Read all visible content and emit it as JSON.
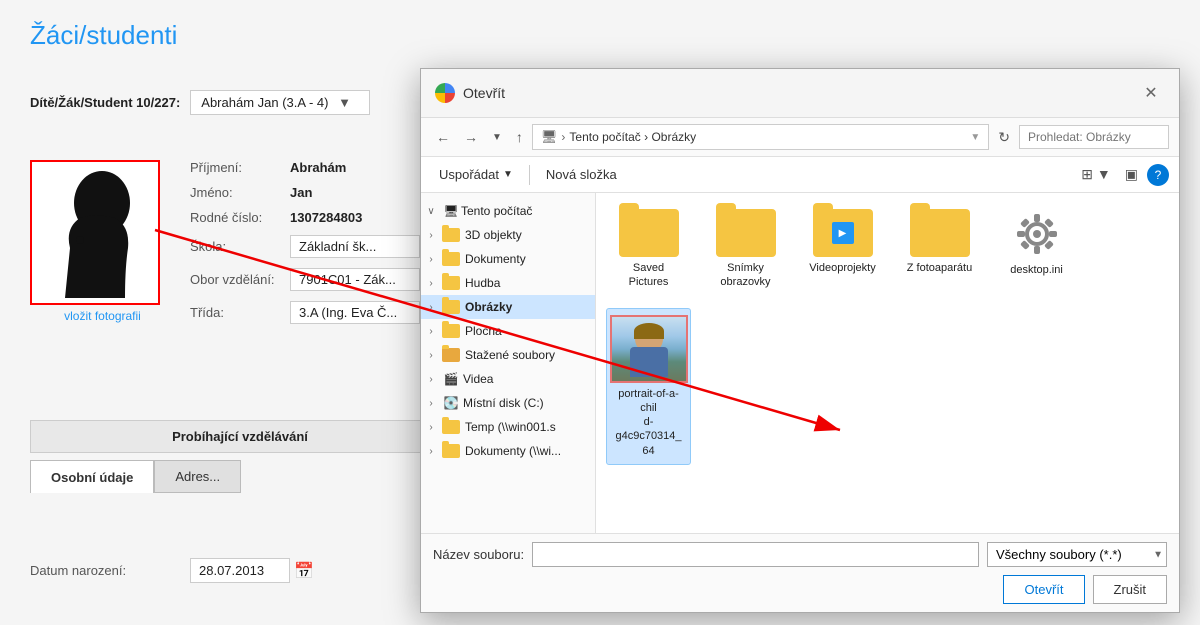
{
  "app": {
    "title": "Žáci/studenti"
  },
  "header": {
    "student_label": "Dítě/Žák/Student 10/227:",
    "student_value": "Abrahám Jan (3.A - 4)"
  },
  "photo": {
    "link_label": "vložit fotografii"
  },
  "fields": {
    "prijmeni_label": "Příjmení:",
    "prijmeni_value": "Abrahám",
    "jmeno_label": "Jméno:",
    "jmeno_value": "Jan",
    "rodne_cislo_label": "Rodné číslo:",
    "rodne_cislo_value": "1307284803",
    "skola_label": "Škola:",
    "skola_value": "Základní šk...",
    "obor_label": "Obor vzdělání:",
    "obor_value": "7901C01 - Zák...",
    "trida_label": "Třída:",
    "trida_value": "3.A (Ing. Eva Č..."
  },
  "section": {
    "header": "Probíhající vzdělávání"
  },
  "tabs": {
    "items": [
      {
        "label": "Osobní údaje",
        "active": true
      },
      {
        "label": "Adres...",
        "active": false
      }
    ]
  },
  "date": {
    "label": "Datum narození:",
    "value": "28.07.2013"
  },
  "dialog": {
    "title": "Otevřít",
    "close_btn": "✕",
    "addr": {
      "back": "←",
      "forward": "→",
      "up": "↑",
      "path": "Tento počítač  ›  Obrázky",
      "search_placeholder": "Prohledat: Obrázky"
    },
    "toolbar": {
      "organize": "Uspořádat",
      "new_folder": "Nová složka",
      "help": "?"
    },
    "sidebar": {
      "items": [
        {
          "label": "Tento počítač",
          "expand": "∨",
          "level": 0,
          "icon": "pc"
        },
        {
          "label": "3D objekty",
          "expand": ">",
          "level": 1,
          "icon": "folder"
        },
        {
          "label": "Dokumenty",
          "expand": ">",
          "level": 1,
          "icon": "folder-doc"
        },
        {
          "label": "Hudba",
          "expand": ">",
          "level": 1,
          "icon": "folder-music"
        },
        {
          "label": "Obrázky",
          "expand": ">",
          "level": 1,
          "icon": "folder",
          "selected": true
        },
        {
          "label": "Plocha",
          "expand": ">",
          "level": 1,
          "icon": "folder-desktop"
        },
        {
          "label": "Stažené soubory",
          "expand": ">",
          "level": 1,
          "icon": "folder-download"
        },
        {
          "label": "Videa",
          "expand": ">",
          "level": 1,
          "icon": "folder-video"
        },
        {
          "label": "Místní disk (C:)",
          "expand": ">",
          "level": 1,
          "icon": "disk"
        },
        {
          "label": "Temp (\\\\win001.s",
          "expand": ">",
          "level": 1,
          "icon": "network-folder"
        },
        {
          "label": "Dokumenty (\\\\win...",
          "expand": ">",
          "level": 1,
          "icon": "network-folder"
        }
      ]
    },
    "files": {
      "row1": [
        {
          "name": "Saved Pictures",
          "type": "folder"
        },
        {
          "name": "Snímky obrazovky",
          "type": "folder"
        },
        {
          "name": "Videoprojekty",
          "type": "folder-video"
        },
        {
          "name": "Z fotoaparátu",
          "type": "folder"
        }
      ],
      "row2": [
        {
          "name": "desktop.ini",
          "type": "gear"
        },
        {
          "name": "portrait-of-a-child-g4c9c70314_64",
          "type": "photo"
        }
      ]
    },
    "bottom": {
      "filename_label": "Název souboru:",
      "filename_value": "",
      "filetype_label": "Všechny soubory (*.*)",
      "btn_open": "Otevřít",
      "btn_cancel": "Zrušit"
    }
  }
}
